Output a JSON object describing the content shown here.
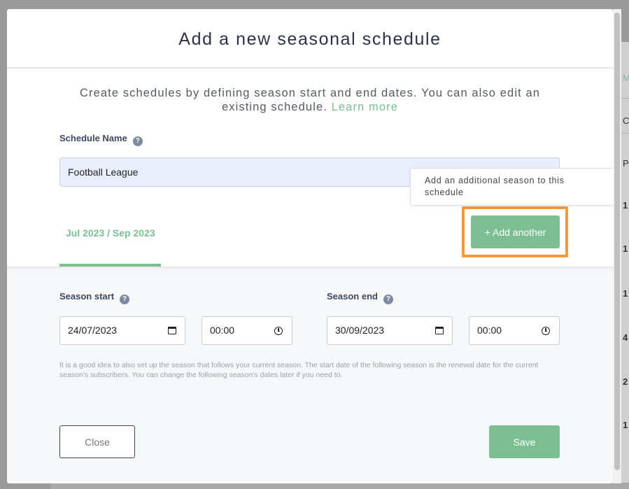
{
  "modal": {
    "title": "Add a new seasonal schedule",
    "intro_text": "Create schedules by defining season start and end dates. You can also edit an existing schedule.",
    "learn_more": "Learn more"
  },
  "schedule_name": {
    "label": "Schedule Name",
    "value": "Football League",
    "help_glyph": "?"
  },
  "tooltip": {
    "text": "Add an additional season to this schedule"
  },
  "season_tab": {
    "label": "Jul 2023 / Sep 2023"
  },
  "add_another": {
    "label": "+ Add another"
  },
  "season": {
    "start_label": "Season start",
    "start_date": "24/07/2023",
    "start_time": "00:00",
    "end_label": "Season end",
    "end_date": "30/09/2023",
    "end_time": "00:00",
    "help_glyph": "?",
    "note": "It is a good idea to also set up the season that follows your current season. The start date of the following season is the renewal date for the current season's subscribers. You can change the following season's dates later if you need to."
  },
  "footer": {
    "close_label": "Close",
    "save_label": "Save"
  },
  "background_page": {
    "tab_fragment": "M",
    "row_letter_c": "C",
    "row_letter_p": "P",
    "row_values": [
      "1",
      "1",
      "1",
      "4",
      "2",
      "1"
    ]
  },
  "colors": {
    "accent_green": "#7cbf93",
    "highlight_orange": "#f39a3c",
    "title_navy": "#2b3345"
  }
}
